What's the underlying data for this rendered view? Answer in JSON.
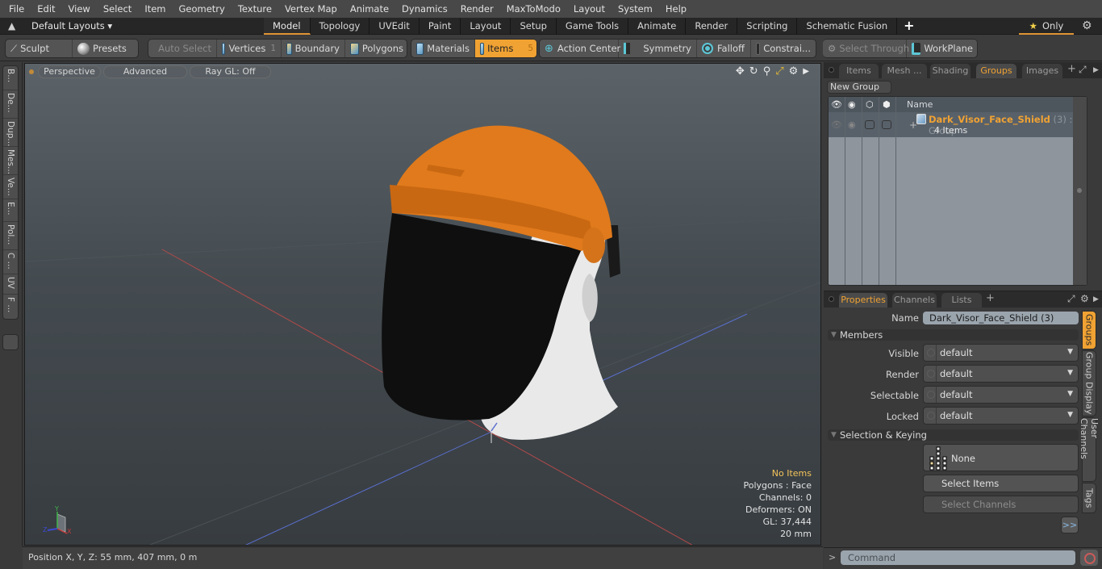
{
  "menu": [
    "File",
    "Edit",
    "View",
    "Select",
    "Item",
    "Geometry",
    "Texture",
    "Vertex Map",
    "Animate",
    "Dynamics",
    "Render",
    "MaxToModo",
    "Layout",
    "System",
    "Help"
  ],
  "layoutbar": {
    "layout_name": "Default Layouts ▾",
    "tabs": [
      "Model",
      "Topology",
      "UVEdit",
      "Paint",
      "Layout",
      "Setup",
      "Game Tools",
      "Animate",
      "Render",
      "Scripting",
      "Schematic Fusion"
    ],
    "active_tab": "Model",
    "add_tab": "+",
    "only_label": "Only"
  },
  "toolbar": {
    "sculpt": "Sculpt",
    "presets": "Presets",
    "auto_select": "Auto Select",
    "vertices": "Vertices",
    "vertices_count": "1",
    "boundary": "Boundary",
    "polygons": "Polygons",
    "materials": "Materials",
    "items": "Items",
    "items_count": "5",
    "action_center": "Action Center",
    "symmetry": "Symmetry",
    "falloff": "Falloff",
    "constraints": "Constrai...",
    "select_through": "Select Through",
    "workplane": "WorkPlane"
  },
  "left_tabs": [
    "B...",
    "De...",
    "Dup...",
    "Mes...",
    "Ve...",
    "E...",
    "Pol...",
    "C ...",
    "UV",
    "F ..."
  ],
  "viewport": {
    "view_mode": "Perspective",
    "shading": "Advanced",
    "raygl": "Ray GL: Off",
    "stats": {
      "selection": "No Items",
      "mode": "Polygons : Face",
      "channels": "Channels: 0",
      "deformers": "Deformers: ON",
      "gl": "GL: 37,444",
      "grid": "20 mm"
    },
    "axis_labels": {
      "x": "X",
      "y": "Y",
      "z": "Z"
    }
  },
  "statusbar": {
    "position": "Position X, Y, Z:   55 mm, 407 mm, 0 m"
  },
  "groups_panel": {
    "tabs": [
      "Items",
      "Mesh ...",
      "Shading",
      "Groups",
      "Images"
    ],
    "active_tab": "Groups",
    "new_group": "New Group",
    "column_name": "Name",
    "group": {
      "name": "Dark_Visor_Face_Shield",
      "meta": " (3) : Group",
      "count": "4 Items"
    }
  },
  "properties_panel": {
    "tabs": [
      "Properties",
      "Channels",
      "Lists"
    ],
    "active_tab": "Properties",
    "name_label": "Name",
    "name_value": "Dark_Visor_Face_Shield (3)",
    "members_section": "Members",
    "fields": [
      {
        "label": "Visible",
        "value": "default"
      },
      {
        "label": "Render",
        "value": "default"
      },
      {
        "label": "Selectable",
        "value": "default"
      },
      {
        "label": "Locked",
        "value": "default"
      }
    ],
    "selection_section": "Selection & Keying",
    "keying_value": "None",
    "select_items": "Select Items",
    "select_channels": "Select Channels",
    "more": ">>",
    "side_tabs": [
      "Groups",
      "Group Display",
      "User Channels",
      "Tags"
    ],
    "active_side_tab": "Groups"
  },
  "command": {
    "prompt": ">",
    "placeholder": "Command"
  },
  "colors": {
    "accent": "#f0a233",
    "helmet": "#e07a1c",
    "visor": "#111111"
  }
}
